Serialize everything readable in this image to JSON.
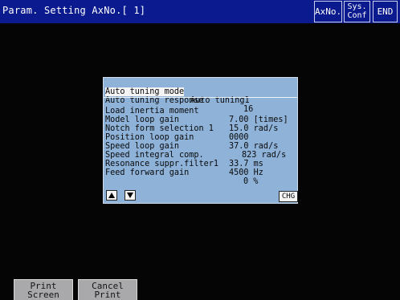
{
  "titlebar": {
    "title": "Param. Setting AxNo.[ 1]",
    "axno_label": "AxNo.",
    "sysconf_line1": "Sys.",
    "sysconf_line2": "Conf",
    "end_label": "END"
  },
  "panel": {
    "rows": [
      {
        "label": "Auto tuning mode",
        "value": "Auto tuning1"
      },
      {
        "label": "Auto tuning response",
        "value": "16"
      },
      {
        "label": "Load inertia moment",
        "value": "7.00 [times]"
      },
      {
        "label": "Model loop gain",
        "value": "15.0 rad/s"
      },
      {
        "label": "Notch form selection 1",
        "value": "0000"
      },
      {
        "label": "Position loop gain",
        "value": "37.0 rad/s"
      },
      {
        "label": "Speed loop gain",
        "value": "823 rad/s"
      },
      {
        "label": "Speed integral comp.",
        "value": "33.7 ms"
      },
      {
        "label": "Resonance suppr.filter1",
        "value": "4500 Hz"
      },
      {
        "label": "Feed forward gain",
        "value": "0 %"
      }
    ],
    "up_icon": "triangle-up-icon",
    "down_icon": "triangle-down-icon",
    "chg_label": "CHG"
  },
  "bottom": {
    "print_screen_line1": "Print",
    "print_screen_line2": "Screen",
    "cancel_print_line1": "Cancel",
    "cancel_print_line2": "Print"
  },
  "colors": {
    "titlebar": "#0b1a8e",
    "panel": "#8eb2d8",
    "screen": "#050505",
    "bezel": "#a9a9ab"
  }
}
